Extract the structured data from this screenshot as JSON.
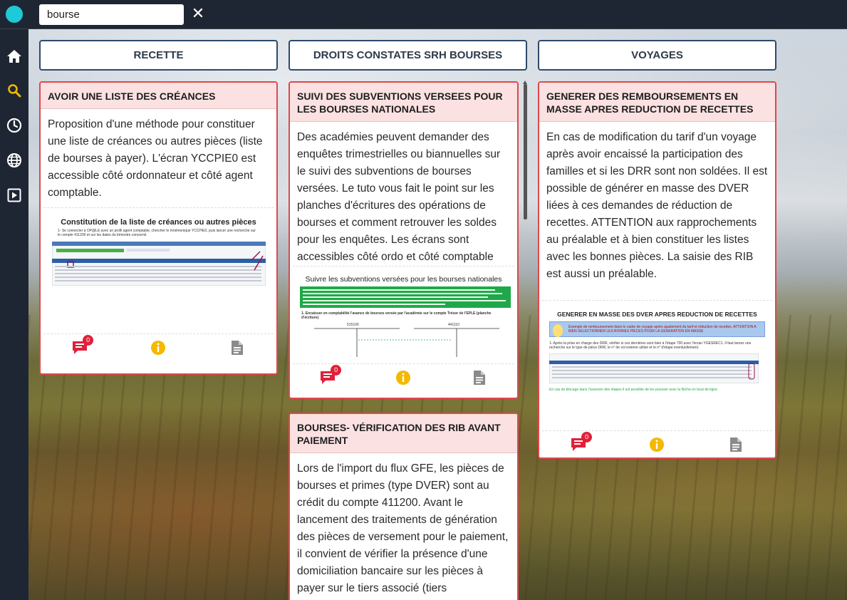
{
  "search": {
    "value": "bourse"
  },
  "sidebar": {
    "items": [
      {
        "name": "home-icon"
      },
      {
        "name": "search-icon"
      },
      {
        "name": "history-icon"
      },
      {
        "name": "globe-icon"
      },
      {
        "name": "video-icon"
      }
    ]
  },
  "columns": [
    {
      "label": "RECETTE"
    },
    {
      "label": "DROITS CONSTATES SRH BOURSES"
    },
    {
      "label": "VOYAGES"
    }
  ],
  "cards": [
    {
      "title": "AVOIR UNE LISTE DES CRÉANCES",
      "body": "Proposition d'une méthode pour constituer une liste de créances ou autres pièces (liste de bourses à payer). L'écran YCCPIE0 est accessible côté ordonnateur et côté agent comptable.",
      "thumb_title": "Constitution de la liste de créances ou autres pièces",
      "thumb_text": "1- Se connecter à OP@LE avec un profil agent comptable, chercher le mnémonique YCCPIE0, puis lancer une recherche sur le compte 411200 et sur les dates du trimestre concerné.",
      "comments": "0"
    },
    {
      "title": "SUIVI DES SUBVENTIONS VERSEES POUR LES BOURSES NATIONALES",
      "body": "Des académies peuvent demander des enquêtes trimestrielles ou biannuelles sur le suivi des subventions de bourses versées. Le tuto vous fait le point sur les planches d'écritures des opérations de bourses et comment retrouver les soldes pour les enquêtes. Les écrans sont accessibles côté ordo et côté comptable",
      "thumb_title": "Suivre les subventions versées pour les bourses nationales",
      "thumb_text": "1- Encaisser en comptabilité l'avance de bourses versée par l'académie sur le compte Trésor de l'EPLE (planche d'écriture)",
      "thumb_accounts": [
        "515100",
        "441110"
      ],
      "comments": "0"
    },
    {
      "title": "GENERER DES REMBOURSEMENTS EN MASSE APRES REDUCTION DE RECETTES",
      "body": "En cas de modification du tarif d'un voyage après avoir encaissé la participation des familles et si les DRR sont non soldées. Il est possible de générer en masse des DVER liées à ces demandes de réduction de recettes. ATTENTION aux rapprochements au préalable et à bien constituer les listes avec les bonnes pièces. La saisie des RIB est aussi un préalable.",
      "thumb_title": "GENERER EN MASSE DES DVER APRES REDUCTION DE RECETTES",
      "thumb_note": "Exemple de remboursement dans le cadre de voyage après ajustement du tarif et réduction de recettes. ATTENTION A BIEN SELECTIONNER LES BONNES PIECES POUR LA GENERATION EN MASSE",
      "thumb_text": "1- Après la prise en charge des DRR, vérifier si ces dernières sont bien à l'étape 700 avec l'écran YGESREC1. Il faut lancer une recherche sur le type de pièce DRR, le n° de vol externe utilisé et le n° d'étape éventuellement.",
      "thumb_footer": "En cas de blocage dans l'avancée des étapes il est possible de les pousser avec la flèche en bout de ligne.",
      "comments": "0"
    },
    {
      "title": "BOURSES- VÉRIFICATION DES RIB AVANT PAIEMENT",
      "body": "Lors de l'import du flux GFE, les pièces de bourses et primes (type DVER) sont au crédit du compte 411200. Avant le lancement des traitements de génération des pièces de versement pour le paiement, il convient de vérifier la présence d'une domiciliation bancaire sur les pièces à payer sur le tiers associé (tiers"
    }
  ],
  "colors": {
    "accent": "#1ec9d8",
    "card_border": "#e0474c",
    "card_header_bg": "#fbe1e1",
    "comment_icon": "#e0203a",
    "info_icon": "#f5b800",
    "doc_icon": "#8a8a8a",
    "search_active": "#f5b800"
  }
}
